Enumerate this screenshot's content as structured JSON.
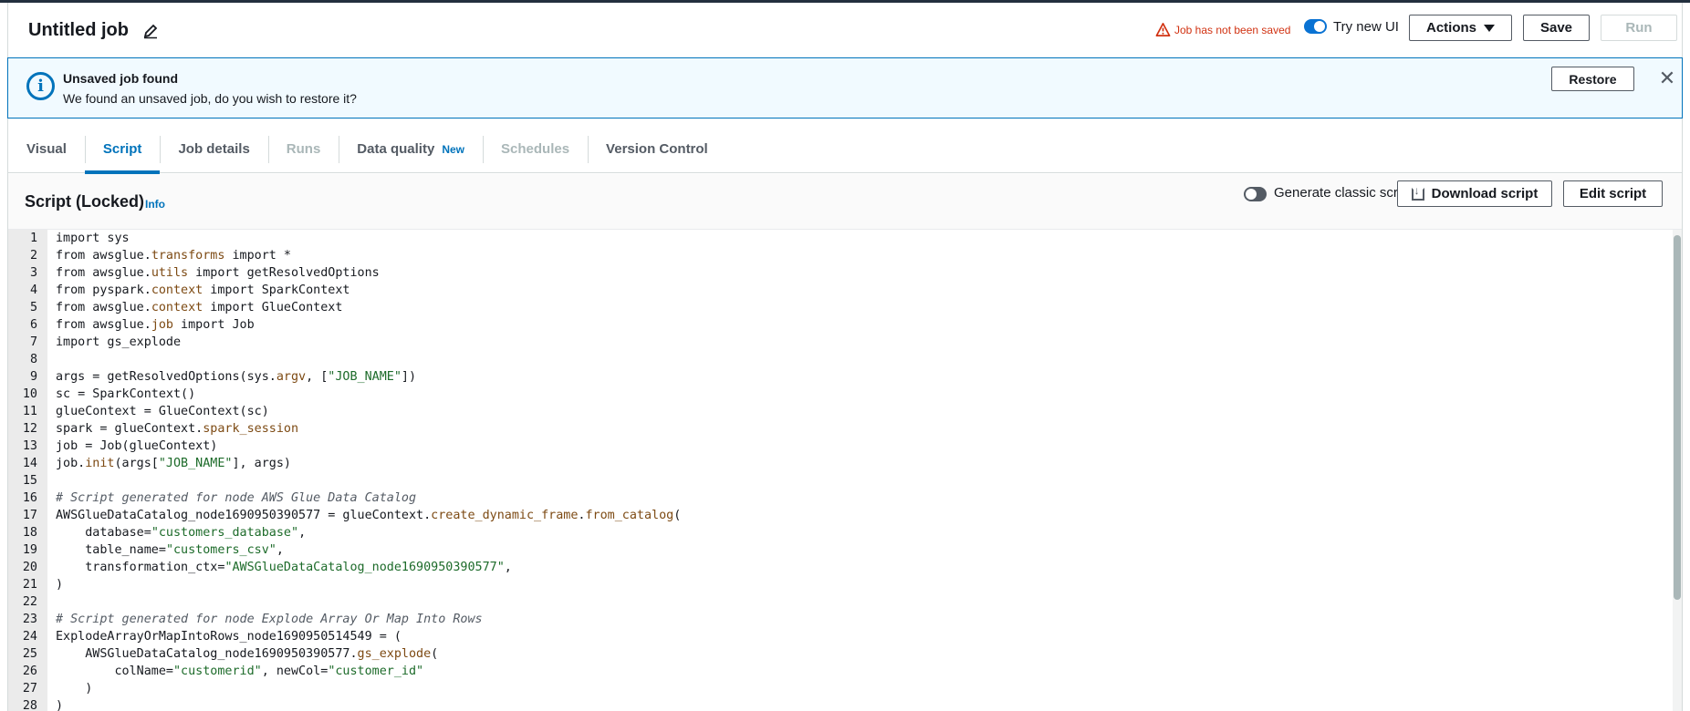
{
  "header": {
    "title": "Untitled job",
    "unsaved_warning": "Job has not been saved",
    "try_new_ui": "Try new UI",
    "actions_label": "Actions",
    "save_label": "Save",
    "run_label": "Run"
  },
  "banner": {
    "title": "Unsaved job found",
    "text": "We found an unsaved job, do you wish to restore it?",
    "restore_label": "Restore"
  },
  "tabs": [
    {
      "label": "Visual",
      "state": "normal"
    },
    {
      "label": "Script",
      "state": "active"
    },
    {
      "label": "Job details",
      "state": "normal"
    },
    {
      "label": "Runs",
      "state": "disabled"
    },
    {
      "label": "Data quality",
      "badge": "New",
      "state": "normal"
    },
    {
      "label": "Schedules",
      "state": "disabled"
    },
    {
      "label": "Version Control",
      "state": "normal"
    }
  ],
  "script": {
    "title": "Script (Locked)",
    "info_label": "Info",
    "generate_classic": "Generate classic script.",
    "download_label": "Download script",
    "edit_label": "Edit script"
  },
  "code_lines": [
    "import sys",
    "from awsglue.transforms import *",
    "from awsglue.utils import getResolvedOptions",
    "from pyspark.context import SparkContext",
    "from awsglue.context import GlueContext",
    "from awsglue.job import Job",
    "import gs_explode",
    "",
    "args = getResolvedOptions(sys.argv, [\"JOB_NAME\"])",
    "sc = SparkContext()",
    "glueContext = GlueContext(sc)",
    "spark = glueContext.spark_session",
    "job = Job(glueContext)",
    "job.init(args[\"JOB_NAME\"], args)",
    "",
    "# Script generated for node AWS Glue Data Catalog",
    "AWSGlueDataCatalog_node1690950390577 = glueContext.create_dynamic_frame.from_catalog(",
    "    database=\"customers_database\",",
    "    table_name=\"customers_csv\",",
    "    transformation_ctx=\"AWSGlueDataCatalog_node1690950390577\",",
    ")",
    "",
    "# Script generated for node Explode Array Or Map Into Rows",
    "ExplodeArrayOrMapIntoRows_node1690950514549 = (",
    "    AWSGlueDataCatalog_node1690950390577.gs_explode(",
    "        colName=\"customerid\", newCol=\"customer_id\"",
    "    )",
    ")"
  ]
}
